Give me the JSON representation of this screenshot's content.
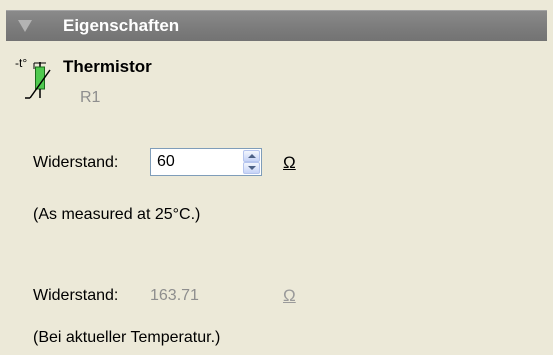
{
  "header": {
    "title": "Eigenschaften",
    "toggle_icon": "collapse-triangle-icon"
  },
  "component": {
    "icon": "thermistor-icon",
    "icon_caption": "-t°",
    "name": "Thermistor",
    "id": "R1"
  },
  "resistance": {
    "label": "Widerstand:",
    "value": "60",
    "unit": "Ω",
    "note": "(As measured at 25°C.)"
  },
  "current_resistance": {
    "label": "Widerstand:",
    "value": "163.71",
    "unit": "Ω",
    "note": "(Bei aktueller Temperatur.)"
  },
  "colors": {
    "header_bg": "#7c7c7c",
    "panel_bg": "#ece9d8",
    "thermistor_green": "#4fc94f",
    "disabled_text": "#8e8e8e"
  }
}
